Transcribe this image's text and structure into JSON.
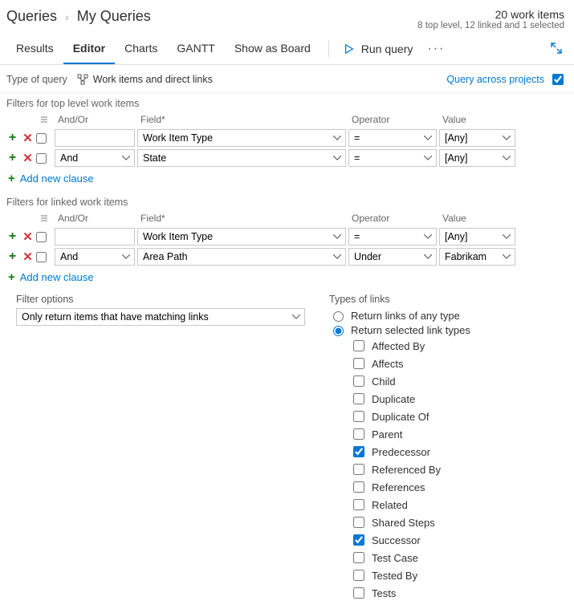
{
  "breadcrumb": {
    "root": "Queries",
    "current": "My Queries"
  },
  "summary": {
    "count": "20 work items",
    "detail": "8 top level, 12 linked and 1 selected"
  },
  "tabs": [
    {
      "label": "Results"
    },
    {
      "label": "Editor"
    },
    {
      "label": "Charts"
    },
    {
      "label": "GANTT"
    },
    {
      "label": "Show as Board"
    }
  ],
  "run_label": "Run query",
  "query_type": {
    "label": "Type of query",
    "value": "Work items and direct links"
  },
  "cross_projects": {
    "label": "Query across projects",
    "checked": true
  },
  "top_section": {
    "title": "Filters for top level work items",
    "headers": {
      "andor": "And/Or",
      "field": "Field*",
      "operator": "Operator",
      "value": "Value"
    },
    "rows": [
      {
        "andor": "",
        "field": "Work Item Type",
        "op": "=",
        "value": "[Any]"
      },
      {
        "andor": "And",
        "field": "State",
        "op": "=",
        "value": "[Any]"
      }
    ],
    "add": "Add new clause"
  },
  "linked_section": {
    "title": "Filters for linked work items",
    "rows": [
      {
        "andor": "",
        "field": "Work Item Type",
        "op": "=",
        "value": "[Any]"
      },
      {
        "andor": "And",
        "field": "Area Path",
        "op": "Under",
        "value": "Fabrikam"
      }
    ],
    "add": "Add new clause"
  },
  "filter_options": {
    "label": "Filter options",
    "value": "Only return items that have matching links"
  },
  "types": {
    "label": "Types of links",
    "radios": [
      {
        "label": "Return links of any type",
        "checked": false
      },
      {
        "label": "Return selected link types",
        "checked": true
      }
    ],
    "checks": [
      {
        "label": "Affected By",
        "checked": false
      },
      {
        "label": "Affects",
        "checked": false
      },
      {
        "label": "Child",
        "checked": false
      },
      {
        "label": "Duplicate",
        "checked": false
      },
      {
        "label": "Duplicate Of",
        "checked": false
      },
      {
        "label": "Parent",
        "checked": false
      },
      {
        "label": "Predecessor",
        "checked": true
      },
      {
        "label": "Referenced By",
        "checked": false
      },
      {
        "label": "References",
        "checked": false
      },
      {
        "label": "Related",
        "checked": false
      },
      {
        "label": "Shared Steps",
        "checked": false
      },
      {
        "label": "Successor",
        "checked": true
      },
      {
        "label": "Test Case",
        "checked": false
      },
      {
        "label": "Tested By",
        "checked": false
      },
      {
        "label": "Tests",
        "checked": false
      }
    ]
  }
}
